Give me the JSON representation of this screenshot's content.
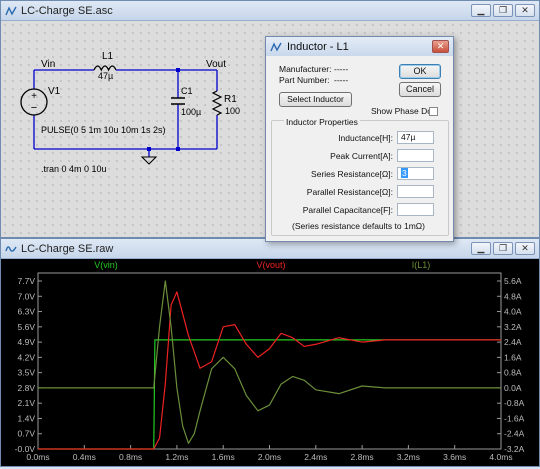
{
  "schematic_window": {
    "title": "LC-Charge SE.asc",
    "labels": {
      "vin": "Vin",
      "vout": "Vout",
      "l1": "L1",
      "l1_val": "47µ",
      "c1": "C1",
      "c1_val": "100µ",
      "r1": "R1",
      "r1_val": "100",
      "v1": "V1",
      "pulse": "PULSE(0 5 1m 10u 10m 1s 2s)",
      "tran": ".tran 0 4m 0 10u"
    }
  },
  "dialog": {
    "title": "Inductor - L1",
    "manufacturer_label": "Manufacturer:",
    "manufacturer_value": "-----",
    "part_label": "Part Number:",
    "part_value": "-----",
    "ok": "OK",
    "cancel": "Cancel",
    "select_inductor": "Select Inductor",
    "show_phase_dot": "Show Phase Dot",
    "group_title": "Inductor Properties",
    "fields": [
      {
        "label": "Inductance[H]:",
        "value": "47µ"
      },
      {
        "label": "Peak Current[A]:",
        "value": ""
      },
      {
        "label": "Series Resistance[Ω]:",
        "value": "3"
      },
      {
        "label": "Parallel Resistance[Ω]:",
        "value": ""
      },
      {
        "label": "Parallel Capacitance[F]:",
        "value": ""
      }
    ],
    "note": "(Series resistance defaults to 1mΩ)"
  },
  "waveform_window": {
    "title": "LC-Charge SE.raw",
    "traces": [
      {
        "name": "V(vin)",
        "color": "#22cc22"
      },
      {
        "name": "V(vout)",
        "color": "#ee2222"
      },
      {
        "name": "I(L1)",
        "color": "#6b8e3a"
      }
    ],
    "left_ticks": [
      "7.7V",
      "7.0V",
      "6.3V",
      "5.6V",
      "4.9V",
      "4.2V",
      "3.5V",
      "2.8V",
      "2.1V",
      "1.4V",
      "0.7V",
      "-0.0V"
    ],
    "right_ticks": [
      "5.6A",
      "4.8A",
      "4.0A",
      "3.2A",
      "2.4A",
      "1.6A",
      "0.8A",
      "0.0A",
      "-0.8A",
      "-1.6A",
      "-2.4A",
      "-3.2A"
    ],
    "x_ticks": [
      "0.0ms",
      "0.4ms",
      "0.8ms",
      "1.2ms",
      "1.6ms",
      "2.0ms",
      "2.4ms",
      "2.8ms",
      "3.2ms",
      "3.6ms",
      "4.0ms"
    ]
  },
  "chart_data": {
    "type": "line",
    "xlabel": "",
    "ylabel": "",
    "x_unit": "ms",
    "xlim": [
      0,
      4.0
    ],
    "ylim_left": [
      0,
      7.7
    ],
    "ylim_right": [
      -3.2,
      5.6
    ],
    "series": [
      {
        "name": "V(vin)",
        "axis": "left",
        "x": [
          0,
          1.0,
          1.01,
          4.0
        ],
        "y": [
          0,
          0,
          5.0,
          5.0
        ]
      },
      {
        "name": "V(vout)",
        "axis": "left",
        "x": [
          0,
          1.0,
          1.05,
          1.1,
          1.15,
          1.2,
          1.3,
          1.4,
          1.5,
          1.6,
          1.7,
          1.8,
          1.9,
          2.0,
          2.1,
          2.2,
          2.3,
          2.4,
          2.6,
          2.8,
          3.0,
          4.0
        ],
        "y": [
          0,
          0,
          0.5,
          3.0,
          6.6,
          7.2,
          5.2,
          3.7,
          4.0,
          5.6,
          5.7,
          4.8,
          4.2,
          4.6,
          5.3,
          5.1,
          4.7,
          4.8,
          5.1,
          4.9,
          5.0,
          5.0
        ]
      },
      {
        "name": "I(L1)",
        "axis": "right",
        "x": [
          0,
          1.0,
          1.05,
          1.1,
          1.15,
          1.2,
          1.25,
          1.3,
          1.35,
          1.4,
          1.5,
          1.6,
          1.7,
          1.8,
          1.9,
          2.0,
          2.1,
          2.2,
          2.3,
          2.4,
          2.6,
          2.8,
          3.0,
          4.0
        ],
        "y": [
          0,
          0,
          3.2,
          5.6,
          3.2,
          0.0,
          -2.0,
          -2.9,
          -2.4,
          -1.2,
          1.0,
          1.6,
          1.0,
          -0.4,
          -1.2,
          -0.9,
          0.2,
          0.6,
          0.4,
          -0.1,
          -0.3,
          0.1,
          0.0,
          0.0
        ]
      }
    ]
  }
}
